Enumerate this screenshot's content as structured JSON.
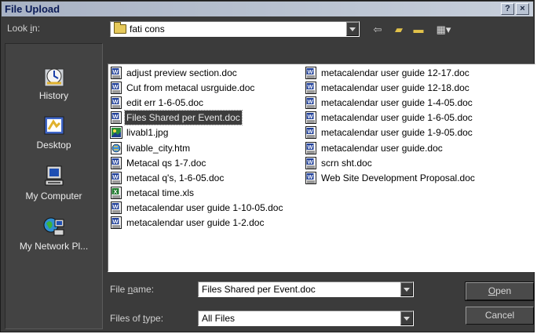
{
  "window": {
    "title": "File Upload",
    "help_label": "?",
    "close_label": "×"
  },
  "look_in": {
    "label_pre": "Look ",
    "label_key": "i",
    "label_post": "n:",
    "value": "fati cons"
  },
  "toolbar": {
    "back_icon": "back-arrow-icon",
    "up_icon": "up-folder-icon",
    "new_folder_icon": "new-folder-icon",
    "view_icon": "view-menu-icon",
    "back_glyph": "⇦",
    "up_glyph": "▰",
    "new_glyph": "▬",
    "view_glyph": "▦▾"
  },
  "places": [
    {
      "label": "History",
      "icon": "history-icon"
    },
    {
      "label": "Desktop",
      "icon": "desktop-icon"
    },
    {
      "label": "My Computer",
      "icon": "my-computer-icon"
    },
    {
      "label": "My Network Pl...",
      "icon": "network-places-icon"
    }
  ],
  "files": {
    "col1": [
      {
        "name": "adjust preview section.doc",
        "type": "word"
      },
      {
        "name": "Cut from metacal usrguide.doc",
        "type": "word"
      },
      {
        "name": "edit err 1-6-05.doc",
        "type": "word"
      },
      {
        "name": "Files Shared per Event.doc",
        "type": "word",
        "selected": true
      },
      {
        "name": "livabl1.jpg",
        "type": "image"
      },
      {
        "name": "livable_city.htm",
        "type": "html"
      },
      {
        "name": "Metacal qs 1-7.doc",
        "type": "word"
      },
      {
        "name": "metacal q's, 1-6-05.doc",
        "type": "word"
      },
      {
        "name": "metacal time.xls",
        "type": "excel"
      },
      {
        "name": "metacalendar user guide 1-10-05.doc",
        "type": "word"
      },
      {
        "name": "metacalendar user guide 1-2.doc",
        "type": "word"
      }
    ],
    "col2": [
      {
        "name": "metacalendar user guide 12-17.doc",
        "type": "word"
      },
      {
        "name": "metacalendar user guide 12-18.doc",
        "type": "word"
      },
      {
        "name": "metacalendar user guide 1-4-05.doc",
        "type": "word"
      },
      {
        "name": "metacalendar user guide 1-6-05.doc",
        "type": "word"
      },
      {
        "name": "metacalendar user guide 1-9-05.doc",
        "type": "word"
      },
      {
        "name": "metacalendar user guide.doc",
        "type": "word"
      },
      {
        "name": "scrn sht.doc",
        "type": "word"
      },
      {
        "name": "Web Site Development Proposal.doc",
        "type": "word"
      }
    ]
  },
  "file_name": {
    "label_pre": "File ",
    "label_key": "n",
    "label_post": "ame:",
    "value": "Files Shared per Event.doc"
  },
  "file_type": {
    "label_pre": "Files of ",
    "label_key": "t",
    "label_post": "ype:",
    "value": "All Files"
  },
  "buttons": {
    "open_key": "O",
    "open_rest": "pen",
    "cancel": "Cancel"
  }
}
